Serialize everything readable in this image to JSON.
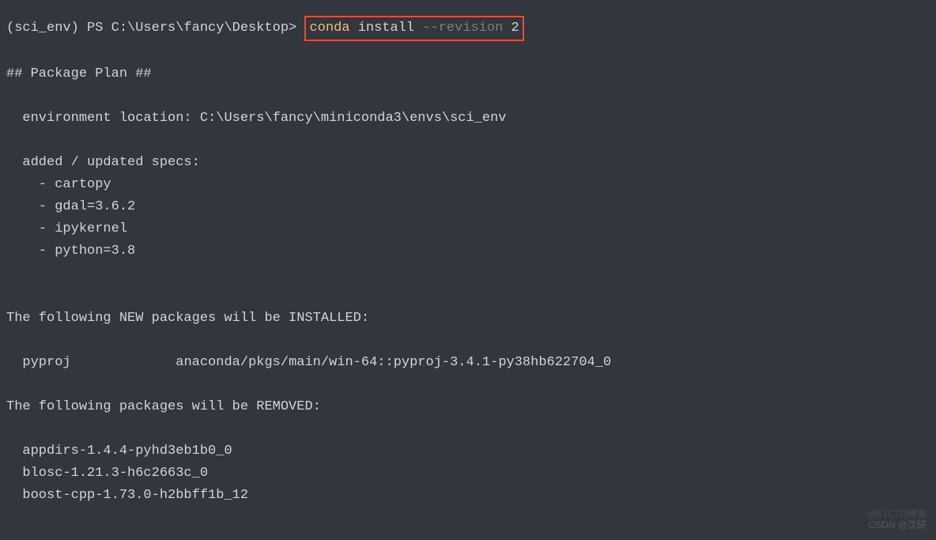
{
  "prompt": {
    "env": "(sci_env)",
    "shell": "PS",
    "path": "C:\\Users\\fancy\\Desktop>",
    "full": "(sci_env) PS C:\\Users\\fancy\\Desktop> "
  },
  "command": {
    "cmd": "conda",
    "sub": "install",
    "flag": "--revision",
    "arg": "2"
  },
  "output": {
    "plan_header": "## Package Plan ##",
    "env_location_label": "  environment location: ",
    "env_location_value": "C:\\Users\\fancy\\miniconda3\\envs\\sci_env",
    "specs_header": "  added / updated specs:",
    "specs": [
      "    - cartopy",
      "    - gdal=3.6.2",
      "    - ipykernel",
      "    - python=3.8"
    ],
    "new_packages_header": "The following NEW packages will be INSTALLED:",
    "new_packages": {
      "name": "  pyproj",
      "padding": "             ",
      "source": "anaconda/pkgs/main/win-64::pyproj-3.4.1-py38hb622704_0"
    },
    "removed_header": "The following packages will be REMOVED:",
    "removed": [
      "  appdirs-1.4.4-pyhd3eb1b0_0",
      "  blosc-1.21.3-h6c2663c_0",
      "  boost-cpp-1.73.0-h2bbff1b_12"
    ]
  },
  "watermark": "CSDN @沈研",
  "watermark2": "@51CTO博客"
}
